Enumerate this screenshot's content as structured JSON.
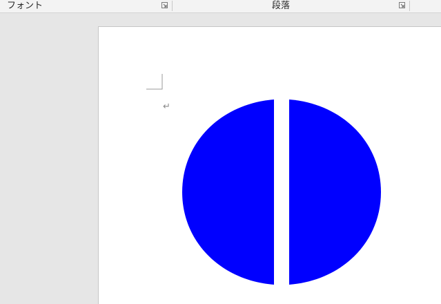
{
  "ribbon": {
    "groups": [
      {
        "label": "フォント"
      },
      {
        "label": "段落"
      }
    ]
  },
  "document": {
    "paragraph_mark": "↵",
    "shape": {
      "kind": "circle-split-vertical",
      "fill_color": "#0000ff"
    }
  },
  "colors": {
    "ribbon_bg": "#f3f3f3",
    "workspace_bg": "#e6e6e6",
    "page_bg": "#ffffff",
    "shape_fill": "#0000ff"
  }
}
